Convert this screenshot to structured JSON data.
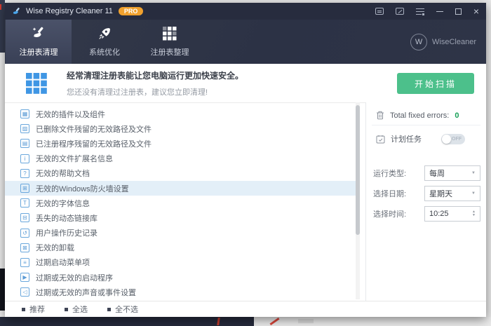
{
  "titlebar": {
    "title": "Wise Registry Cleaner 11",
    "badge": "PRO"
  },
  "tabs": [
    {
      "label": "注册表清理",
      "active": true
    },
    {
      "label": "系统优化",
      "active": false
    },
    {
      "label": "注册表整理",
      "active": false
    }
  ],
  "brand": {
    "name": "WiseCleaner",
    "logo_letter": "W"
  },
  "banner": {
    "headline": "经常清理注册表能让您电脑运行更加快速安全。",
    "subline": "您还没有清理过注册表，建议您立即清理!",
    "scan_button": "开始扫描"
  },
  "list": {
    "items": [
      {
        "label": "无效的插件以及组件",
        "icon": "plugin-icon",
        "glyph": "▦",
        "selected": false
      },
      {
        "label": "已删除文件残留的无效路径及文件",
        "icon": "deleted-file-icon",
        "glyph": "▨",
        "selected": false
      },
      {
        "label": "已注册程序残留的无效路径及文件",
        "icon": "registered-program-icon",
        "glyph": "▤",
        "selected": false
      },
      {
        "label": "无效的文件扩展名信息",
        "icon": "file-extension-icon",
        "glyph": "i",
        "selected": false
      },
      {
        "label": "无效的帮助文档",
        "icon": "help-doc-icon",
        "glyph": "?",
        "selected": false
      },
      {
        "label": "无效的Windows防火墙设置",
        "icon": "firewall-icon",
        "glyph": "⊞",
        "selected": true
      },
      {
        "label": "无效的字体信息",
        "icon": "font-icon",
        "glyph": "T",
        "selected": false
      },
      {
        "label": "丢失的动态链接库",
        "icon": "dll-icon",
        "glyph": "⊟",
        "selected": false
      },
      {
        "label": "用户操作历史记录",
        "icon": "history-icon",
        "glyph": "↺",
        "selected": false
      },
      {
        "label": "无效的卸载",
        "icon": "uninstall-icon",
        "glyph": "⊠",
        "selected": false
      },
      {
        "label": "过期启动菜单项",
        "icon": "start-menu-icon",
        "glyph": "≡",
        "selected": false
      },
      {
        "label": "过期或无效的启动程序",
        "icon": "startup-program-icon",
        "glyph": "▶",
        "selected": false
      },
      {
        "label": "过期或无效的声音或事件设置",
        "icon": "sound-event-icon",
        "glyph": "◁",
        "selected": false
      }
    ]
  },
  "panel": {
    "fixed_errors_label": "Total fixed errors:",
    "fixed_errors_value": "0",
    "schedule": {
      "label": "计划任务",
      "toggle": "OFF"
    },
    "fields": [
      {
        "label": "运行类型:",
        "value": "每周",
        "control": "select"
      },
      {
        "label": "选择日期:",
        "value": "星期天",
        "control": "select"
      },
      {
        "label": "选择时间:",
        "value": "10:25",
        "control": "time-spinner"
      }
    ]
  },
  "footer": {
    "options": [
      "推荐",
      "全选",
      "全不选"
    ]
  },
  "icons": {
    "minimize": "–",
    "maximize": "",
    "close": "×",
    "caret_down": "▼",
    "spinner_up": "▲",
    "spinner_down": "▼",
    "logo_letter": "W"
  },
  "colors": {
    "header_navy": "#2e3447",
    "titlebar_navy": "#272c3e",
    "accent_green": "#4cc08b",
    "badge_orange": "#f0a12e",
    "banner_icon_blue": "#3f96e4",
    "list_icon_blue": "#5b9bd5",
    "selected_row_blue": "#e3eff8",
    "error_count_green": "#18a058"
  }
}
